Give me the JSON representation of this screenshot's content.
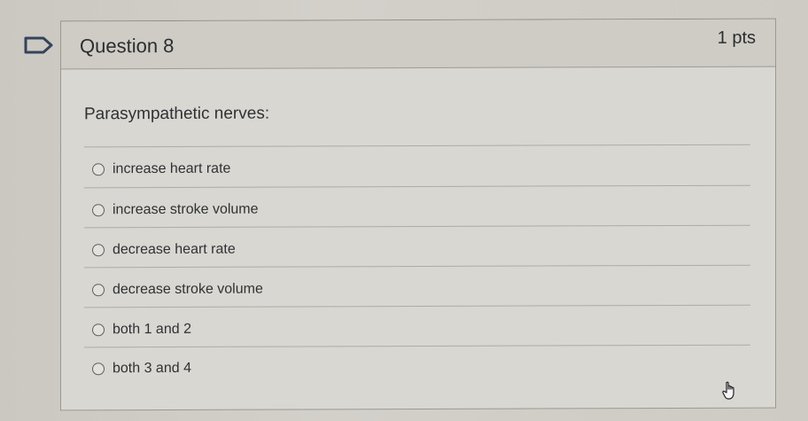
{
  "question": {
    "title": "Question 8",
    "points": "1 pts",
    "prompt": "Parasympathetic nerves:",
    "answers": [
      {
        "label": "increase heart rate",
        "selected": false
      },
      {
        "label": "increase stroke volume",
        "selected": false
      },
      {
        "label": "decrease heart rate",
        "selected": false
      },
      {
        "label": "decrease stroke volume",
        "selected": false
      },
      {
        "label": "both 1 and 2",
        "selected": false
      },
      {
        "label": "both 3 and 4",
        "selected": false
      }
    ]
  },
  "icons": {
    "flag": "flag-outline-icon",
    "cursor": "hand-pointer-icon"
  },
  "colors": {
    "text": "#2f3134",
    "border": "#9a9893",
    "header_bg": "#cfccc5"
  }
}
